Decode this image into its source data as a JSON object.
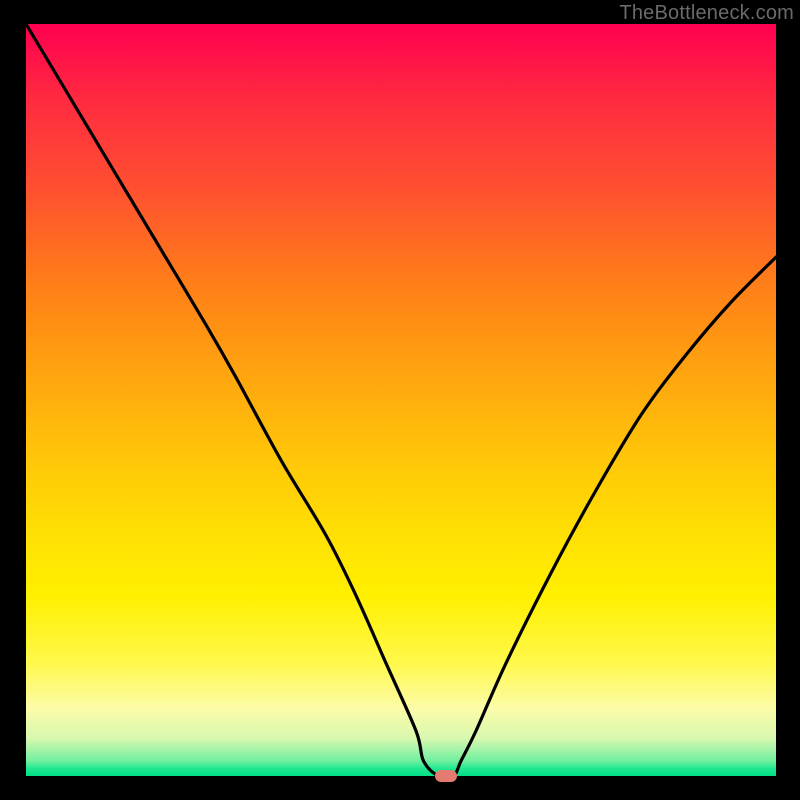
{
  "watermark": "TheBottleneck.com",
  "colors": {
    "frame": "#000000",
    "watermark": "#6a6a6a",
    "curve": "#000000",
    "marker": "#e47a70",
    "gradient_top": "#ff0050",
    "gradient_bottom": "#00df88"
  },
  "chart_data": {
    "type": "line",
    "title": "",
    "subtitle": "",
    "xlabel": "",
    "ylabel": "",
    "xlim": [
      0,
      100
    ],
    "ylim": [
      0,
      100
    ],
    "grid": false,
    "legend": false,
    "annotations": [
      "TheBottleneck.com"
    ],
    "series": [
      {
        "name": "bottleneck-curve",
        "color": "#000000",
        "x": [
          0,
          6,
          12,
          18,
          24,
          28,
          34,
          40,
          44,
          48,
          52,
          53,
          55,
          57,
          58,
          60,
          64,
          70,
          76,
          82,
          88,
          94,
          100
        ],
        "y": [
          100,
          90,
          80,
          70,
          60,
          53,
          42,
          32,
          24,
          15,
          6,
          2,
          0,
          0,
          2,
          6,
          15,
          27,
          38,
          48,
          56,
          63,
          69
        ]
      }
    ],
    "marker": {
      "x": 56,
      "y": 0,
      "shape": "rounded-rect",
      "color": "#e47a70"
    },
    "background": {
      "type": "vertical-gradient",
      "stops": [
        {
          "pos": 0,
          "color": "#ff0050"
        },
        {
          "pos": 45,
          "color": "#ffa010"
        },
        {
          "pos": 76,
          "color": "#fff000"
        },
        {
          "pos": 100,
          "color": "#00df88"
        }
      ]
    }
  }
}
